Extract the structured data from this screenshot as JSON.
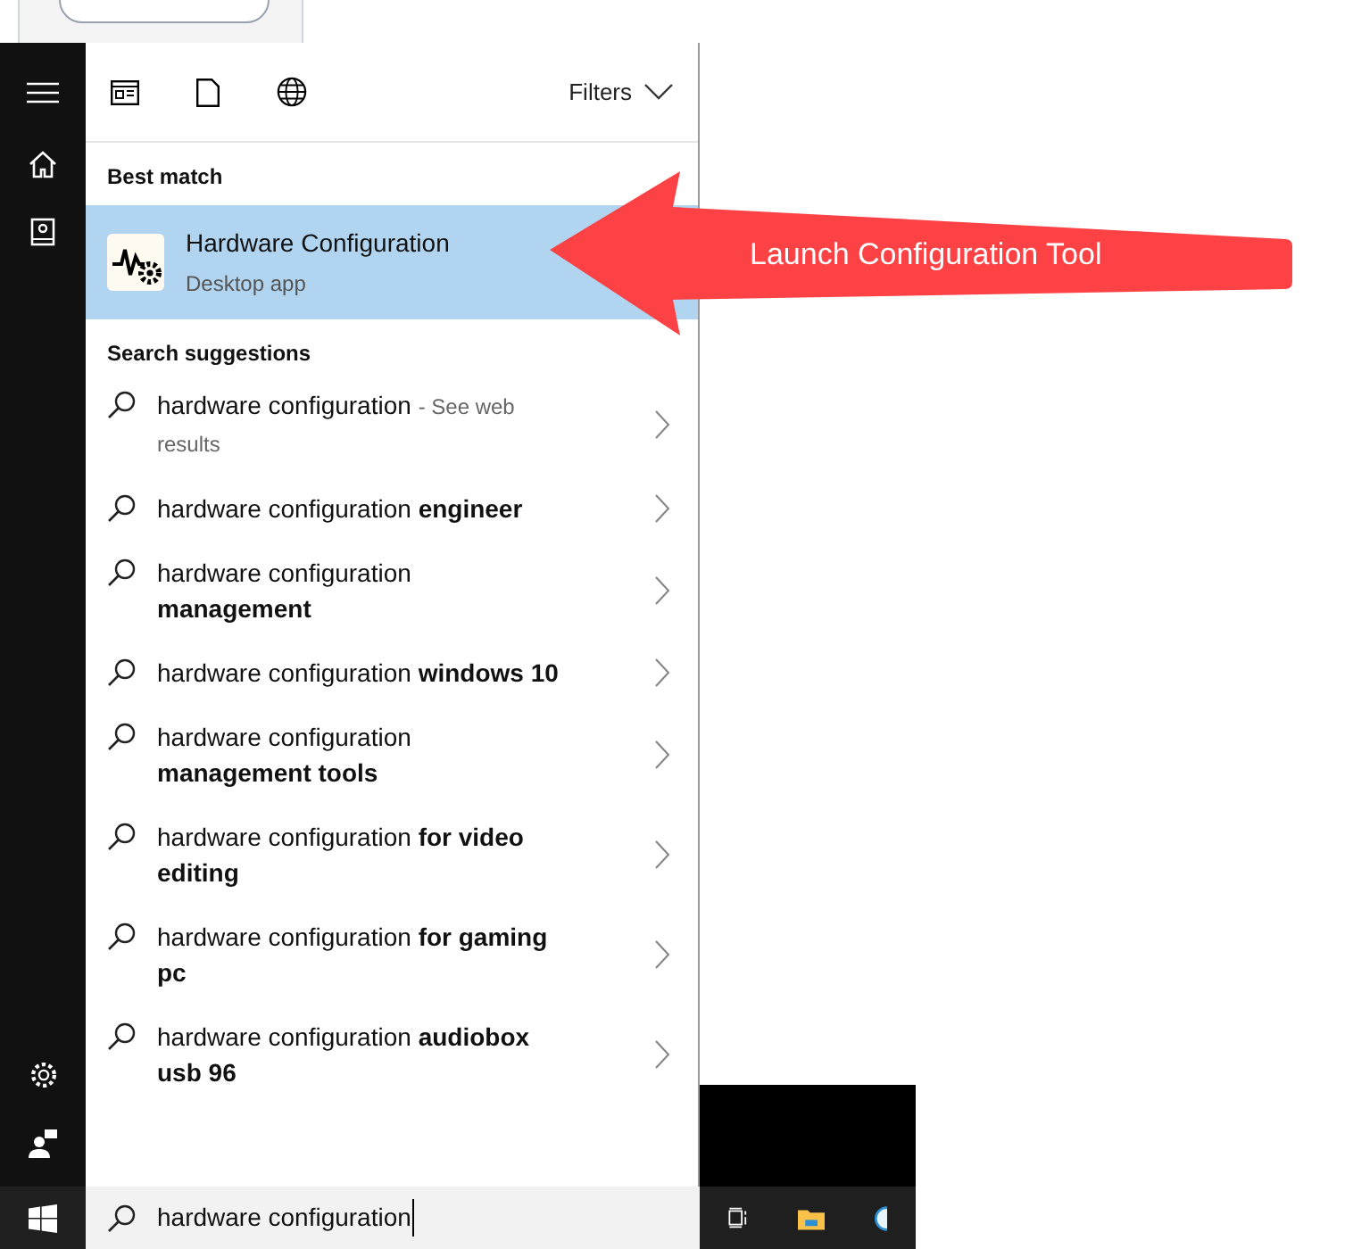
{
  "toolbar": {
    "filters_label": "Filters"
  },
  "best_match": {
    "heading": "Best match",
    "title": "Hardware Configuration",
    "subtitle": "Desktop app",
    "selected": true
  },
  "suggestions_heading": "Search suggestions",
  "suggestions": [
    {
      "kind": "web",
      "text": "hardware configuration",
      "hint": "- See web results"
    },
    {
      "kind": "plain",
      "text": "hardware configuration **engineer**"
    },
    {
      "kind": "plain",
      "text": "hardware configuration **management**"
    },
    {
      "kind": "plain",
      "text": "hardware configuration **windows 10**"
    },
    {
      "kind": "plain",
      "text": "hardware configuration **management tools**"
    },
    {
      "kind": "plain",
      "text": "hardware configuration **for video editing**"
    },
    {
      "kind": "plain",
      "text": "hardware configuration **for gaming pc**"
    },
    {
      "kind": "plain",
      "text": "hardware configuration **audiobox usb 96**"
    }
  ],
  "search_box": {
    "value": "hardware configuration"
  },
  "callout": {
    "text": "Launch Configuration Tool"
  }
}
